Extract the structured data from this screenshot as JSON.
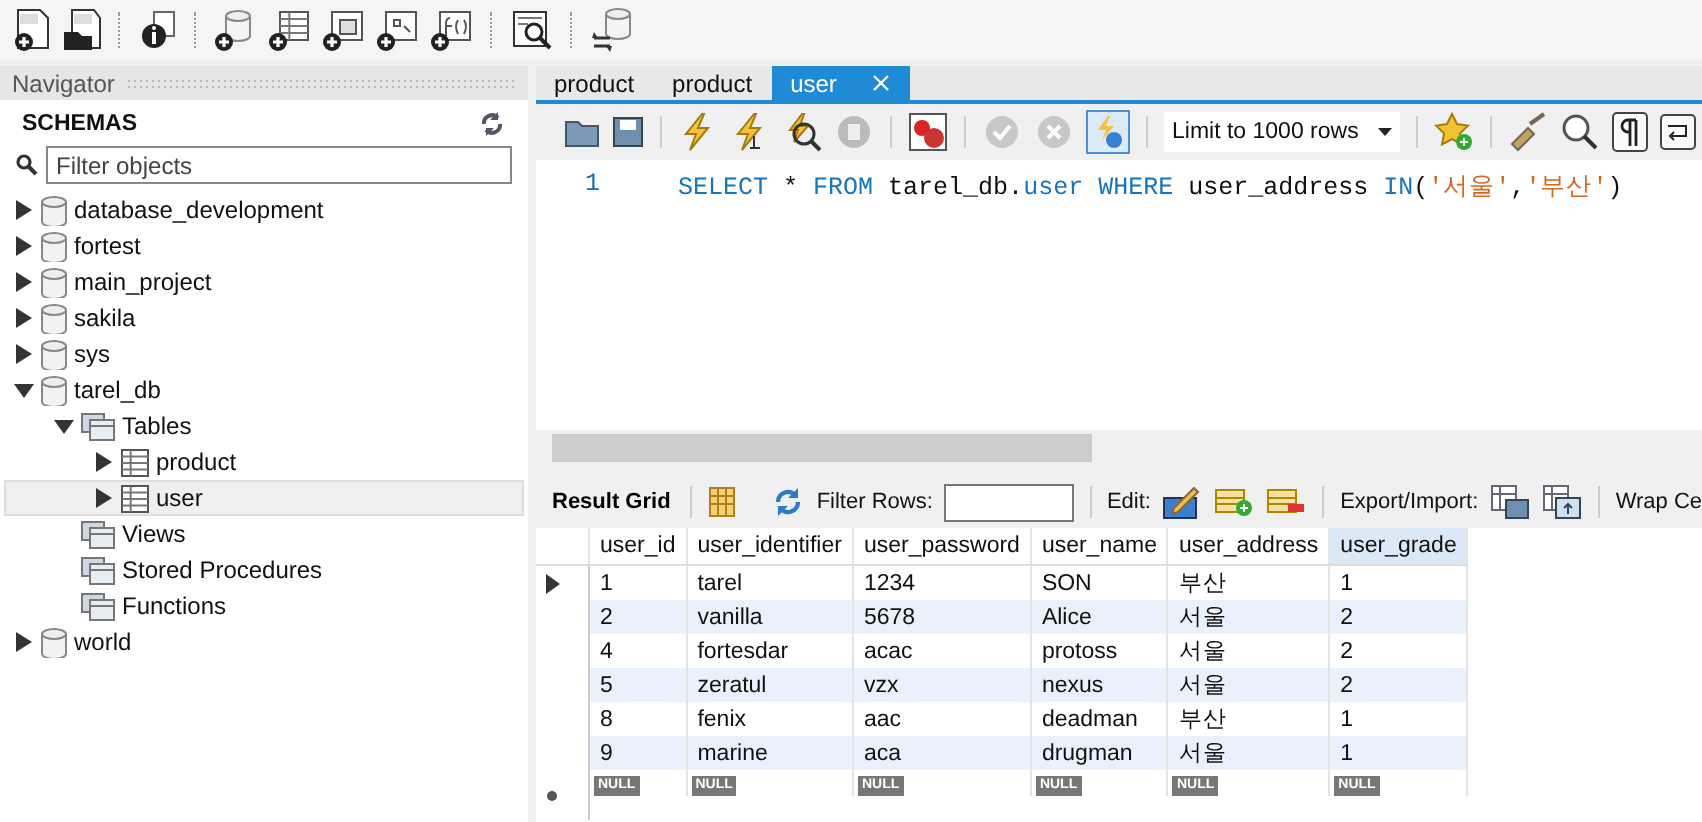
{
  "navigator": {
    "title": "Navigator",
    "heading": "SCHEMAS",
    "filter": {
      "placeholder": "Filter objects"
    },
    "tree": [
      {
        "label": "database_development",
        "kind": "schema",
        "expanded": false,
        "selected": false
      },
      {
        "label": "fortest",
        "kind": "schema",
        "expanded": false,
        "selected": false
      },
      {
        "label": "main_project",
        "kind": "schema",
        "expanded": false,
        "selected": false
      },
      {
        "label": "sakila",
        "kind": "schema",
        "expanded": false,
        "selected": false
      },
      {
        "label": "sys",
        "kind": "schema",
        "expanded": false,
        "selected": false
      },
      {
        "label": "tarel_db",
        "kind": "schema",
        "expanded": true,
        "selected": false,
        "children": [
          {
            "label": "Tables",
            "kind": "folder",
            "expanded": true,
            "selected": false,
            "children": [
              {
                "label": "product",
                "kind": "table",
                "expanded": false,
                "selected": false
              },
              {
                "label": "user",
                "kind": "table",
                "expanded": false,
                "selected": true
              }
            ]
          },
          {
            "label": "Views",
            "kind": "folder",
            "selected": false
          },
          {
            "label": "Stored Procedures",
            "kind": "folder",
            "selected": false
          },
          {
            "label": "Functions",
            "kind": "folder",
            "selected": false
          }
        ]
      },
      {
        "label": "world",
        "kind": "schema",
        "expanded": false,
        "selected": false
      }
    ]
  },
  "editor": {
    "tabs": [
      {
        "label": "product",
        "selected": false
      },
      {
        "label": "product",
        "selected": false
      },
      {
        "label": "user",
        "selected": true
      }
    ],
    "row_limit": "Limit to 1000 rows",
    "lines": [
      {
        "number": "1",
        "tokens": [
          {
            "kind": "keyword",
            "text": "SELECT"
          },
          {
            "kind": "plain",
            "text": " * "
          },
          {
            "kind": "keyword",
            "text": "FROM"
          },
          {
            "kind": "plain",
            "text": " tarel_db."
          },
          {
            "kind": "keyword",
            "text": "user "
          },
          {
            "kind": "keyword",
            "text": "WHERE"
          },
          {
            "kind": "plain",
            "text": " user_address "
          },
          {
            "kind": "keyword",
            "text": "IN"
          },
          {
            "kind": "plain",
            "text": "("
          },
          {
            "kind": "string",
            "text": "'서울'"
          },
          {
            "kind": "plain",
            "text": ","
          },
          {
            "kind": "string",
            "text": "'부산'"
          },
          {
            "kind": "plain",
            "text": ")"
          }
        ]
      }
    ]
  },
  "results": {
    "view_button": "Result Grid",
    "filter_label": "Filter Rows:",
    "edit_label": "Edit:",
    "export_label": "Export/Import:",
    "wrap_label": "Wrap Ce",
    "columns": [
      {
        "label": "user_id",
        "selected": false
      },
      {
        "label": "user_identifier",
        "selected": false
      },
      {
        "label": "user_password",
        "selected": false
      },
      {
        "label": "user_name",
        "selected": false
      },
      {
        "label": "user_address",
        "selected": false
      },
      {
        "label": "user_grade",
        "selected": true
      }
    ],
    "rows": [
      {
        "current": true,
        "cells": [
          "1",
          "tarel",
          "1234",
          "SON",
          "부산",
          "1"
        ]
      },
      {
        "current": false,
        "cells": [
          "2",
          "vanilla",
          "5678",
          "Alice",
          "서울",
          "2"
        ]
      },
      {
        "current": false,
        "cells": [
          "4",
          "fortesdar",
          "acac",
          "protoss",
          "서울",
          "2"
        ]
      },
      {
        "current": false,
        "cells": [
          "5",
          "zeratul",
          "vzx",
          "nexus",
          "서울",
          "2"
        ]
      },
      {
        "current": false,
        "cells": [
          "8",
          "fenix",
          "aac",
          "deadman",
          "부산",
          "1"
        ]
      },
      {
        "current": false,
        "cells": [
          "9",
          "marine",
          "aca",
          "drugman",
          "서울",
          "1"
        ]
      }
    ],
    "new_row": [
      "NULL",
      "NULL",
      "NULL",
      "NULL",
      "NULL",
      "NULL"
    ]
  }
}
